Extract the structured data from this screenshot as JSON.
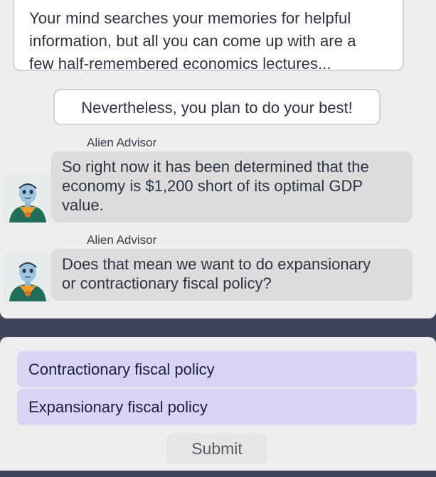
{
  "narration": {
    "lines": [
      "Your mind searches your memories for helpful",
      "information, but all you can come up with are a",
      "few half-remembered economics lectures..."
    ]
  },
  "thought": {
    "text": "Nevertheless, you plan to do your best!"
  },
  "messages": [
    {
      "sender": "Alien Advisor",
      "avatar_icon": "alien-advisor-avatar-icon",
      "lines": [
        "So right now it has been determined that the",
        "economy is $1,200 short of its optimal GDP",
        "value."
      ]
    },
    {
      "sender": "Alien Advisor",
      "avatar_icon": "alien-advisor-avatar-icon",
      "lines": [
        "Does that mean we want to do expansionary",
        "or contractionary fiscal policy?"
      ]
    }
  ],
  "response": {
    "choices": [
      "Contractionary fiscal policy",
      "Expansionary fiscal policy"
    ],
    "submit_label": "Submit"
  },
  "colors": {
    "page_background": "#3d4459",
    "panel_background": "#eeeeee",
    "bubble_background": "#dcdcdc",
    "choice_background": "#d8d4f3",
    "text_dark": "#2f3240"
  }
}
